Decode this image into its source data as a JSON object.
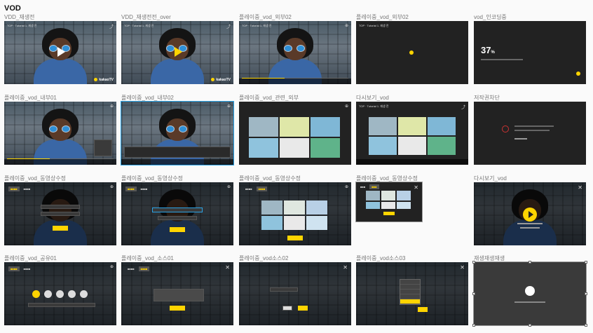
{
  "page": {
    "section_title": "VOD"
  },
  "cells": [
    {
      "label": "VDD_재생전",
      "variant": "play-white"
    },
    {
      "label": "VDD_재생전전_over",
      "variant": "play-yellow"
    },
    {
      "label": "플레이중_vod_외부02",
      "variant": "playing"
    },
    {
      "label": "플레이중_vod_외부02",
      "variant": "loading-dot"
    },
    {
      "label": "vod_인코딩중",
      "variant": "encoding",
      "progress_text": "37",
      "progress_unit": "%"
    },
    {
      "label": "플레이중_vod_내부01",
      "variant": "inner01"
    },
    {
      "label": "플레이중_vod_내부02",
      "variant": "inner02"
    },
    {
      "label": "플레이중_vod_관련_외부",
      "variant": "related"
    },
    {
      "label": "다시보기_vod",
      "variant": "related2"
    },
    {
      "label": "저작권차단",
      "variant": "blocked"
    },
    {
      "label": "플레이중_vod_동영상수정",
      "variant": "edit1"
    },
    {
      "label": "플레이중_vod_동영상수정",
      "variant": "edit2"
    },
    {
      "label": "플레이중_vod_동영상수정",
      "variant": "edit3"
    },
    {
      "label": "플레이중_vod_동영상수정",
      "variant": "edit4"
    },
    {
      "label": "다시보기_vod",
      "variant": "replay"
    },
    {
      "label": "플레이중_vod_공유01",
      "variant": "share"
    },
    {
      "label": "플레이중_vod_소스01",
      "variant": "source1"
    },
    {
      "label": "플레이중_vod소스02",
      "variant": "source2"
    },
    {
      "label": "플레이중_vod소스03",
      "variant": "source3"
    },
    {
      "label": "재생재생재생",
      "variant": "selected-logo"
    }
  ],
  "brand_label": "kakaoTV",
  "colors": {
    "accent": "#ffd400",
    "selection": "#2aa3e6",
    "background": "#fafafa"
  }
}
